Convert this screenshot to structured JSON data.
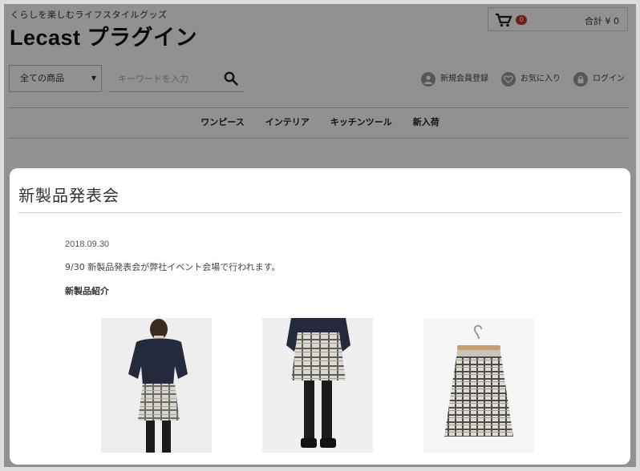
{
  "header": {
    "tagline": "くらしを楽しむライフスタイルグッズ",
    "site_title": "Lecast プラグイン",
    "cart_count": "0",
    "cart_total": "合計 ¥ 0"
  },
  "search": {
    "category_value": "全ての商品",
    "placeholder": "キーワードを入力"
  },
  "user_links": [
    {
      "label": "新規会員登録",
      "icon": "user-icon"
    },
    {
      "label": "お気に入り",
      "icon": "heart-icon"
    },
    {
      "label": "ログイン",
      "icon": "lock-icon"
    }
  ],
  "nav": {
    "items": [
      "ワンピース",
      "インテリア",
      "キッチンツール",
      "新入荷"
    ]
  },
  "modal": {
    "title": "新製品発表会",
    "date": "2018.09.30",
    "body": "9/30 新製品発表会が弊社イベント会場で行われます。",
    "subtitle": "新製品紹介",
    "products": [
      {
        "icon": "model-top-skirt-photo"
      },
      {
        "icon": "model-skirt-closeup-photo"
      },
      {
        "icon": "skirt-on-hanger-photo"
      }
    ]
  },
  "colors": {
    "cart_badge": "#c0392b",
    "overlay": "#000000",
    "modal_bg": "#ffffff"
  }
}
